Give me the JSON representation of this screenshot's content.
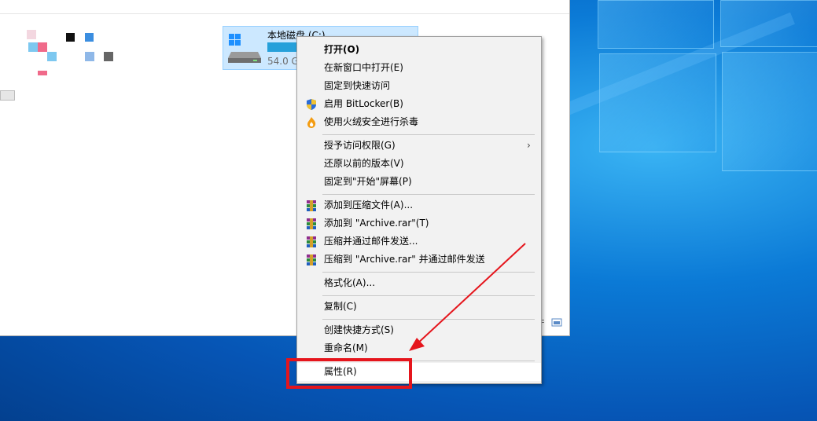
{
  "drive": {
    "name": "本地磁盘 (C:)",
    "free_text": "54.0 G",
    "used_fraction": 0.75
  },
  "context_menu": {
    "groups": [
      [
        {
          "label": "打开(O)",
          "bold": true
        },
        {
          "label": "在新窗口中打开(E)"
        },
        {
          "label": "固定到快速访问"
        },
        {
          "label": "启用 BitLocker(B)",
          "icon": "shield-icon"
        },
        {
          "label": "使用火绒安全进行杀毒",
          "icon": "huorong-icon"
        }
      ],
      [
        {
          "label": "授予访问权限(G)",
          "submenu": true
        },
        {
          "label": "还原以前的版本(V)"
        },
        {
          "label": "固定到\"开始\"屏幕(P)"
        }
      ],
      [
        {
          "label": "添加到压缩文件(A)...",
          "icon": "winrar-icon"
        },
        {
          "label": "添加到 \"Archive.rar\"(T)",
          "icon": "winrar-icon"
        },
        {
          "label": "压缩并通过邮件发送...",
          "icon": "winrar-icon"
        },
        {
          "label": "压缩到 \"Archive.rar\" 并通过邮件发送",
          "icon": "winrar-icon"
        }
      ],
      [
        {
          "label": "格式化(A)..."
        }
      ],
      [
        {
          "label": "复制(C)"
        }
      ],
      [
        {
          "label": "创建快捷方式(S)"
        },
        {
          "label": "重命名(M)"
        }
      ],
      [
        {
          "label": "属性(R)",
          "highlighted": true
        }
      ]
    ]
  },
  "annotation": {
    "highlight_color": "#e5151c",
    "highlighted_item": "属性(R)"
  }
}
